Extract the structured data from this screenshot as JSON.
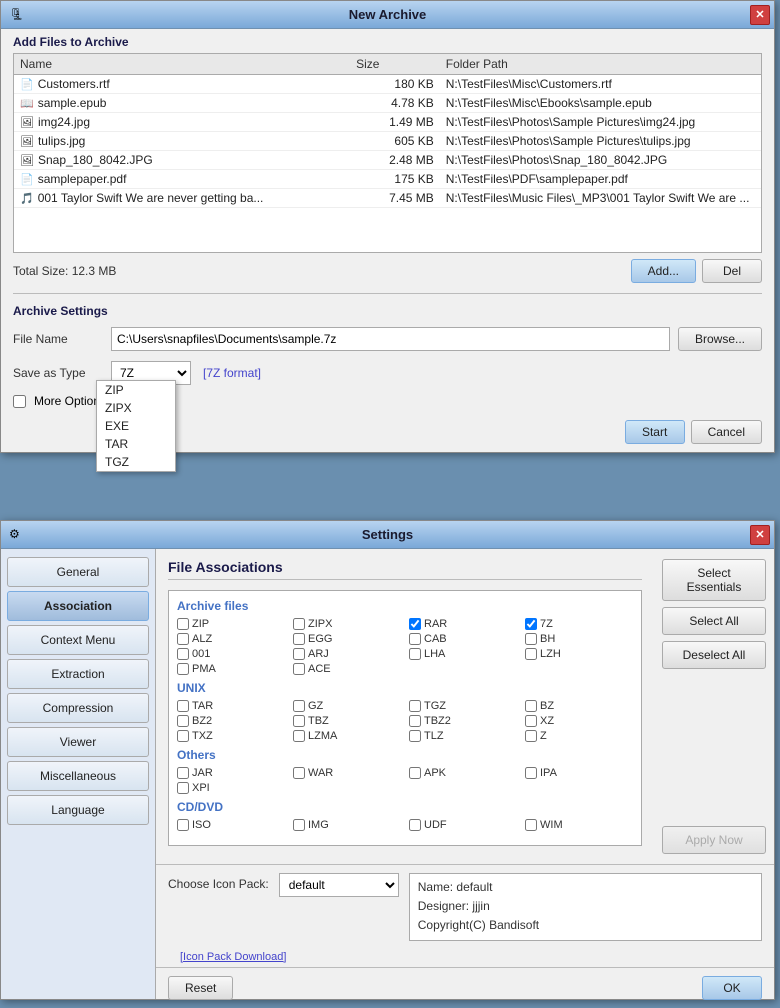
{
  "archiveWindow": {
    "title": "New Archive",
    "sectionTitle": "Add Files to Archive",
    "columns": [
      "Name",
      "Size",
      "Folder Path"
    ],
    "files": [
      {
        "icon": "📄",
        "name": "Customers.rtf",
        "size": "180 KB",
        "path": "N:\\TestFiles\\Misc\\Customers.rtf"
      },
      {
        "icon": "📖",
        "name": "sample.epub",
        "size": "4.78 KB",
        "path": "N:\\TestFiles\\Misc\\Ebooks\\sample.epub"
      },
      {
        "icon": "🖼",
        "name": "img24.jpg",
        "size": "1.49 MB",
        "path": "N:\\TestFiles\\Photos\\Sample Pictures\\img24.jpg"
      },
      {
        "icon": "🖼",
        "name": "tulips.jpg",
        "size": "605 KB",
        "path": "N:\\TestFiles\\Photos\\Sample Pictures\\tulips.jpg"
      },
      {
        "icon": "🖼",
        "name": "Snap_180_8042.JPG",
        "size": "2.48 MB",
        "path": "N:\\TestFiles\\Photos\\Snap_180_8042.JPG"
      },
      {
        "icon": "📄",
        "name": "samplepaper.pdf",
        "size": "175 KB",
        "path": "N:\\TestFiles\\PDF\\samplepaper.pdf"
      },
      {
        "icon": "🎵",
        "name": "001 Taylor Swift We are never getting ba...",
        "size": "7.45 MB",
        "path": "N:\\TestFiles\\Music Files\\_MP3\\001 Taylor Swift We are ..."
      }
    ],
    "totalSize": "Total Size: 12.3 MB",
    "addButton": "Add...",
    "delButton": "Del",
    "archiveSettingsTitle": "Archive Settings",
    "fileNameLabel": "File Name",
    "fileNameValue": "C:\\Users\\snapfiles\\Documents\\sample.7z",
    "browseButton": "Browse...",
    "saveAsTypeLabel": "Save as Type",
    "saveAsTypeValue": "7Z",
    "formatNote": "[7Z format]",
    "moreOptionsLabel": "More Options...",
    "startButton": "Start",
    "cancelButton": "Cancel",
    "dropdownItems": [
      "ZIP",
      "ZIPX",
      "EXE",
      "TAR",
      "TGZ"
    ]
  },
  "settingsWindow": {
    "title": "Settings",
    "sidebarItems": [
      {
        "label": "General",
        "active": false
      },
      {
        "label": "Association",
        "active": true
      },
      {
        "label": "Context Menu",
        "active": false
      },
      {
        "label": "Extraction",
        "active": false
      },
      {
        "label": "Compression",
        "active": false
      },
      {
        "label": "Viewer",
        "active": false
      },
      {
        "label": "Miscellaneous",
        "active": false
      },
      {
        "label": "Language",
        "active": false
      }
    ],
    "contentTitle": "File Associations",
    "archiveFilesGroup": "Archive files",
    "archiveCheckboxes": [
      {
        "label": "ZIP",
        "checked": false
      },
      {
        "label": "ZIPX",
        "checked": false
      },
      {
        "label": "RAR",
        "checked": true
      },
      {
        "label": "7Z",
        "checked": true
      },
      {
        "label": "ALZ",
        "checked": false
      },
      {
        "label": "EGG",
        "checked": false
      },
      {
        "label": "CAB",
        "checked": false
      },
      {
        "label": "BH",
        "checked": false
      },
      {
        "label": "001",
        "checked": false
      },
      {
        "label": "ARJ",
        "checked": false
      },
      {
        "label": "LHA",
        "checked": false
      },
      {
        "label": "LZH",
        "checked": false
      },
      {
        "label": "PMA",
        "checked": false
      },
      {
        "label": "ACE",
        "checked": false
      }
    ],
    "unixGroup": "UNIX",
    "unixCheckboxes": [
      {
        "label": "TAR",
        "checked": false
      },
      {
        "label": "GZ",
        "checked": false
      },
      {
        "label": "TGZ",
        "checked": false
      },
      {
        "label": "BZ",
        "checked": false
      },
      {
        "label": "BZ2",
        "checked": false
      },
      {
        "label": "TBZ",
        "checked": false
      },
      {
        "label": "TBZ2",
        "checked": false
      },
      {
        "label": "XZ",
        "checked": false
      },
      {
        "label": "TXZ",
        "checked": false
      },
      {
        "label": "LZMA",
        "checked": false
      },
      {
        "label": "TLZ",
        "checked": false
      },
      {
        "label": "Z",
        "checked": false
      }
    ],
    "othersGroup": "Others",
    "othersCheckboxes": [
      {
        "label": "JAR",
        "checked": false
      },
      {
        "label": "WAR",
        "checked": false
      },
      {
        "label": "APK",
        "checked": false
      },
      {
        "label": "IPA",
        "checked": false
      },
      {
        "label": "XPI",
        "checked": false
      }
    ],
    "cdDvdGroup": "CD/DVD",
    "cdDvdCheckboxes": [
      {
        "label": "ISO",
        "checked": false
      },
      {
        "label": "IMG",
        "checked": false
      },
      {
        "label": "UDF",
        "checked": false
      },
      {
        "label": "WIM",
        "checked": false
      }
    ],
    "selectEssentialsButton": "Select Essentials",
    "selectAllButton": "Select All",
    "deselectAllButton": "Deselect All",
    "applyNowButton": "Apply Now",
    "iconPackLabel": "Choose Icon Pack:",
    "iconPackValue": "default",
    "iconPackOptions": [
      "default"
    ],
    "iconPackInfoName": "Name: default",
    "iconPackInfoDesigner": "Designer: jjjin",
    "iconPackInfoCopyright": "Copyright(C) Bandisoft",
    "iconPackLink": "[Icon Pack Download]",
    "resetButton": "Reset",
    "okButton": "OK"
  }
}
